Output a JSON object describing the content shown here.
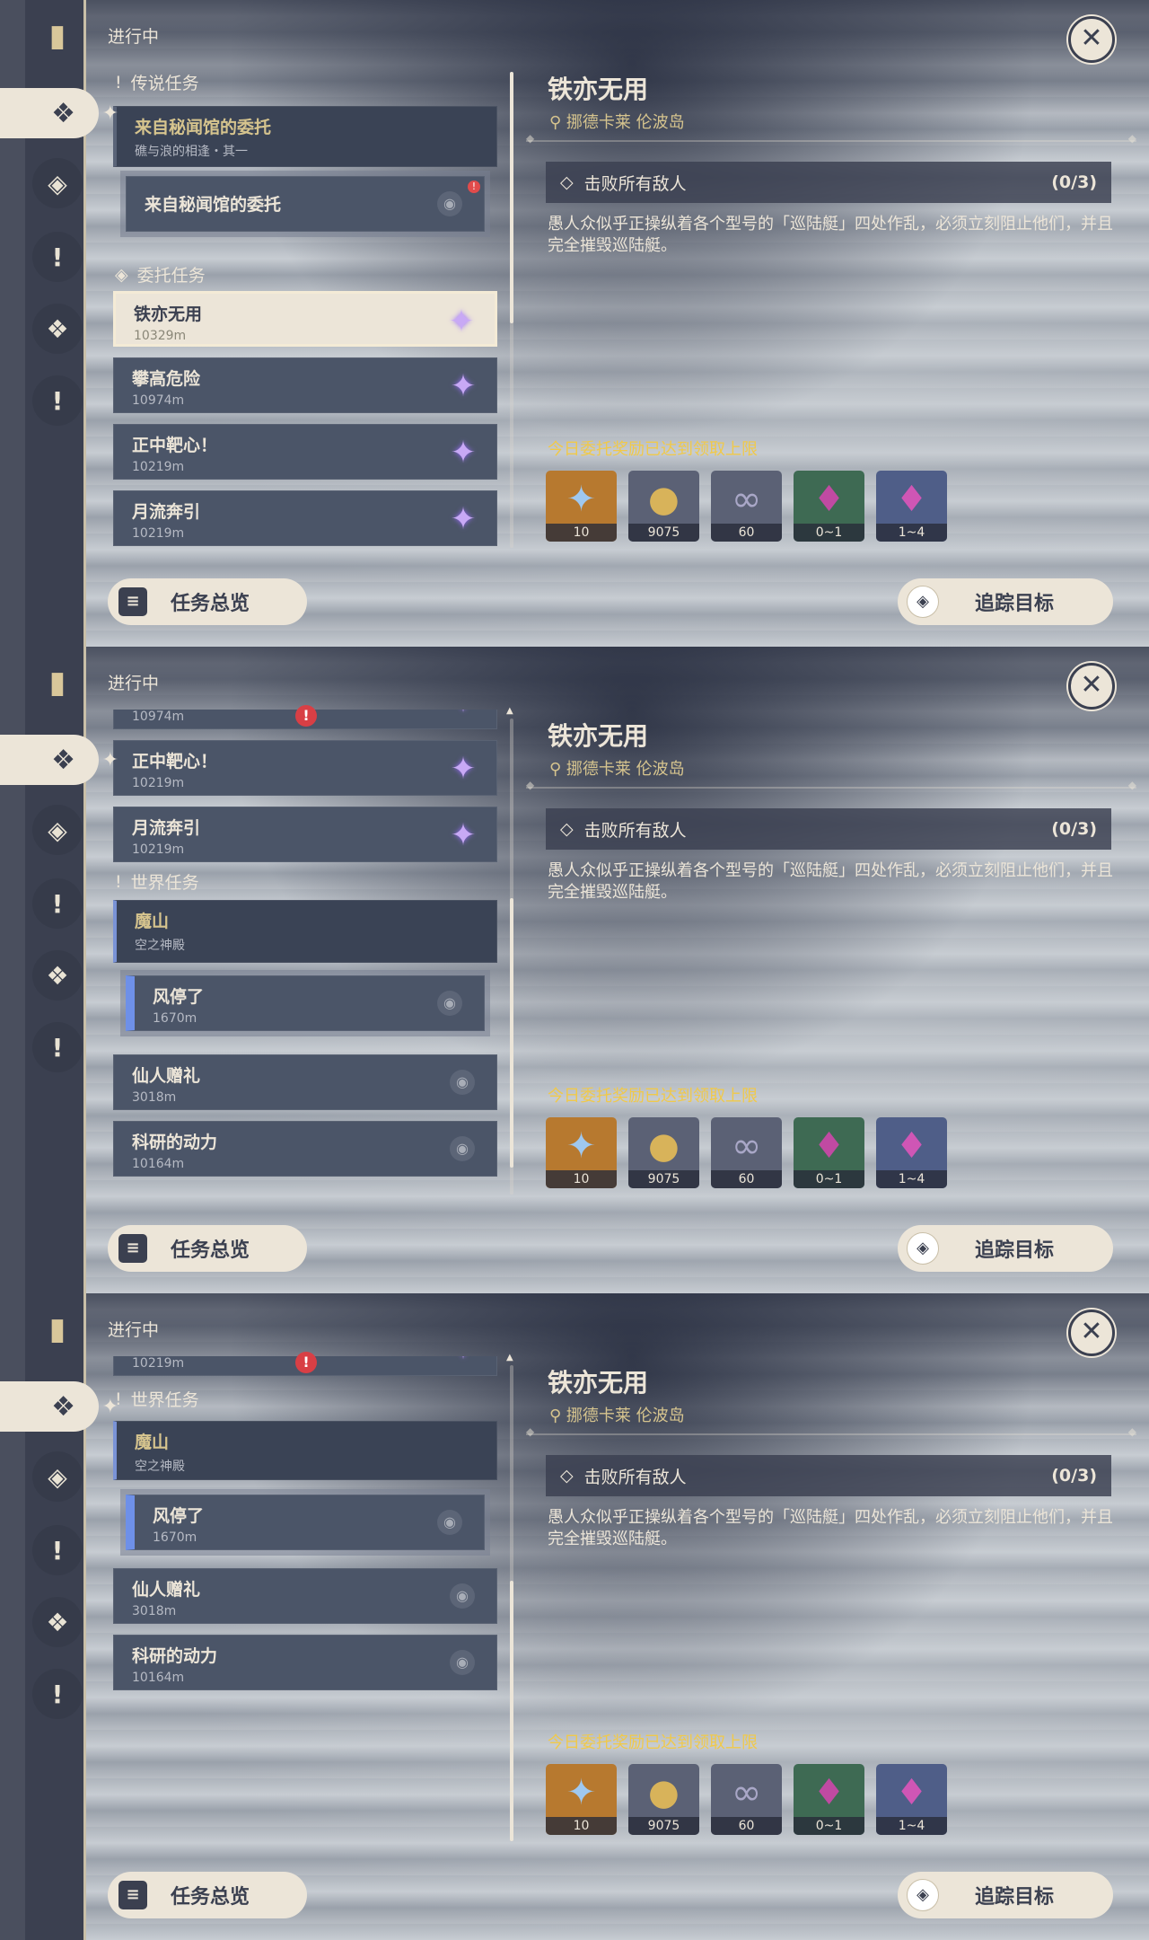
{
  "header": {
    "status": "进行中"
  },
  "sections": {
    "legend": "传说任务",
    "commission": "委托任务",
    "world": "世界任务"
  },
  "quests": {
    "legend_group": {
      "title": "来自秘闻馆的委托",
      "sub": "礁与浪的相逢・其一"
    },
    "legend_step": {
      "title": "来自秘闻馆的委托"
    },
    "c1": {
      "title": "铁亦无用",
      "dist": "10329m"
    },
    "c2": {
      "title": "攀高危险",
      "dist": "10974m"
    },
    "c3": {
      "title": "正中靶心！",
      "dist": "10219m"
    },
    "c4": {
      "title": "月流奔引",
      "dist": "10219m"
    },
    "world_group": {
      "title": "魔山",
      "sub": "空之神殿"
    },
    "world_step": {
      "title": "风停了",
      "dist": "1670m"
    },
    "w2": {
      "title": "仙人赠礼",
      "dist": "3018m"
    },
    "w3": {
      "title": "科研的动力",
      "dist": "10164m"
    }
  },
  "detail": {
    "title": "铁亦无用",
    "location": "挪德卡莱 伦波岛",
    "objective": "击败所有敌人",
    "progress": "(0/3)",
    "description": "愚人众似乎正操纵着各个型号的「巡陆艇」四处作乱，必须立刻阻止他们，并且完全摧毁巡陆艇。",
    "limit_notice": "今日委托奖励已达到领取上限",
    "rewards": [
      {
        "icon": "adventure-exp-icon",
        "amount": "10",
        "bg": "#b7792f"
      },
      {
        "icon": "mora-icon",
        "amount": "9075",
        "bg": "#5b6175"
      },
      {
        "icon": "companionship-icon",
        "amount": "60",
        "bg": "#5b6175"
      },
      {
        "icon": "crystal-shard-icon",
        "amount": "0~1",
        "bg": "#3e6a53"
      },
      {
        "icon": "crystal-cluster-icon",
        "amount": "1~4",
        "bg": "#4f5e88"
      }
    ]
  },
  "buttons": {
    "overview": "任务总览",
    "track": "追踪目标"
  },
  "colors": {
    "accent_gold": "#d6c48e",
    "limit_yellow": "#f0c94a",
    "panel_cream": "#ece5d8",
    "gem_purple": "#c8a9f5"
  }
}
